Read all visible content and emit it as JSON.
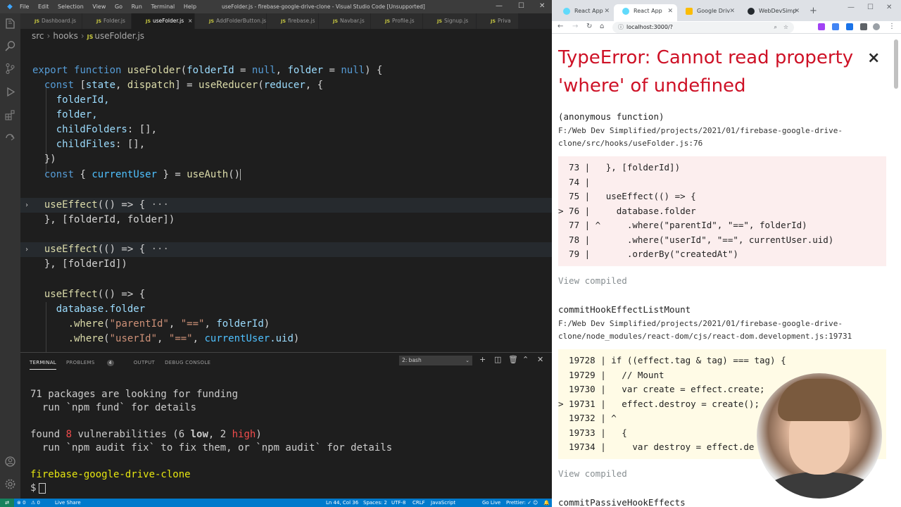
{
  "vscode": {
    "menu": [
      "File",
      "Edit",
      "Selection",
      "View",
      "Go",
      "Run",
      "Terminal",
      "Help"
    ],
    "window_title": "useFolder.js - firebase-google-drive-clone - Visual Studio Code [Unsupported]",
    "tabs": [
      {
        "label": "Dashboard.js",
        "active": false
      },
      {
        "label": "Folder.js",
        "active": false
      },
      {
        "label": "useFolder.js",
        "active": true
      },
      {
        "label": "AddFolderButton.js",
        "active": false
      },
      {
        "label": "firebase.js",
        "active": false
      },
      {
        "label": "Navbar.js",
        "active": false
      },
      {
        "label": "Profile.js",
        "active": false
      },
      {
        "label": "Signup.js",
        "active": false
      },
      {
        "label": "Priva",
        "active": false
      }
    ],
    "tab_file_badge": "JS",
    "tab_close": "×",
    "breadcrumb": [
      "src",
      "hooks",
      "useFolder.js"
    ],
    "code": {
      "l1_export": "export",
      "l1_function": "function",
      "l1_name": "useFolder",
      "l1_p1": "folderId",
      "l1_eq": " = ",
      "l1_null1": "null",
      "l1_comma": ", ",
      "l1_p2": "folder",
      "l1_null2": "null",
      "l1_end": ") {",
      "l2_const": "const",
      "l2_state": "state",
      "l2_dispatch": "dispatch",
      "l2_useReducer": "useReducer",
      "l2_reducer": "reducer",
      "l3": "folderId,",
      "l4": "folder,",
      "l5_key": "childFolders",
      "l5_val": ": [],",
      "l6_key": "childFiles",
      "l6_val": ": [],",
      "l7": "})",
      "l8_const": "const",
      "l8_currentUser": "currentUser",
      "l8_useAuth": "useAuth",
      "l9_useEffect": "useEffect",
      "l9_arrow": "(() => {",
      "l9_dots": "···",
      "l10": "}, [folderId, folder])",
      "l11_useEffect": "useEffect",
      "l11_arrow": "(() => {",
      "l11_dots": "···",
      "l12": "}, [folderId])",
      "l13_useEffect": "useEffect",
      "l13_arrow": "(() => {",
      "l14_database": "database",
      "l14_folder": ".folder",
      "l15_where": ".where",
      "l15_s1": "\"parentId\"",
      "l15_s2": "\"==\"",
      "l15_var": "folderId",
      "l16_where": ".where",
      "l16_s1": "\"userId\"",
      "l16_s2": "\"==\"",
      "l16_var": "currentUser",
      "l16_uid": ".uid"
    },
    "panel": {
      "tabs": [
        "TERMINAL",
        "PROBLEMS",
        "OUTPUT",
        "DEBUG CONSOLE"
      ],
      "problems_count": "4",
      "terminal_select": "2: bash"
    },
    "terminal": {
      "l1": "71 packages are looking for funding",
      "l2": "  run `npm fund` for details",
      "l3_a": "found ",
      "l3_n": "8",
      "l3_b": " vulnerabilities (6 ",
      "l3_low": "low",
      "l3_c": ", 2 ",
      "l3_high": "high",
      "l3_d": ")",
      "l4": "  run `npm audit fix` to fix them, or `npm audit` for details",
      "l5": "firebase-google-drive-clone",
      "prompt": "$"
    },
    "status": {
      "errors": "⊗ 0",
      "warnings": "⚠ 0",
      "live_share": "Live Share",
      "position": "Ln 44, Col 36",
      "spaces": "Spaces: 2",
      "encoding": "UTF-8",
      "eol": "CRLF",
      "language": "JavaScript",
      "go_live": "Go Live",
      "prettier": "Prettier: ✓"
    }
  },
  "chrome": {
    "tabs": [
      {
        "label": "React App",
        "active": false
      },
      {
        "label": "React App",
        "active": true
      },
      {
        "label": "Google Driv",
        "active": false
      },
      {
        "label": "WebDevSimp",
        "active": false
      }
    ],
    "new_tab": "+",
    "url": "localhost:3000/?",
    "overlay": {
      "title": "TypeError: Cannot read property 'where' of undefined",
      "close": "×",
      "frame1_fn": "(anonymous function)",
      "frame1_path": "F:/Web Dev Simplified/projects/2021/01/firebase-google-drive-clone/src/hooks/useFolder.js:76",
      "frame1_code": [
        "  73 |   }, [folderId])",
        "  74 |",
        "  75 |   useEffect(() => {",
        "> 76 |     database.folder",
        "  77 | ^     .where(\"parentId\", \"==\", folderId)",
        "  78 |       .where(\"userId\", \"==\", currentUser.uid)",
        "  79 |       .orderBy(\"createdAt\")"
      ],
      "view_compiled": "View compiled",
      "frame2_fn": "commitHookEffectListMount",
      "frame2_path": "F:/Web Dev Simplified/projects/2021/01/firebase-google-drive-clone/node_modules/react-dom/cjs/react-dom.development.js:19731",
      "frame2_code": [
        "  19728 | if ((effect.tag & tag) === tag) {",
        "  19729 |   // Mount",
        "  19730 |   var create = effect.create;",
        "> 19731 |   effect.destroy = create();",
        "  19732 | ^",
        "  19733 |   {",
        "  19734 |     var destroy = effect.de"
      ],
      "frame3_fn": "commitPassiveHookEffects"
    }
  },
  "colors": {
    "vscode_bg": "#1e1e1e",
    "statusbar": "#007acc",
    "error_red": "#ce1126",
    "terminal_yellow": "#e5e510",
    "terminal_red": "#f14c4c"
  }
}
